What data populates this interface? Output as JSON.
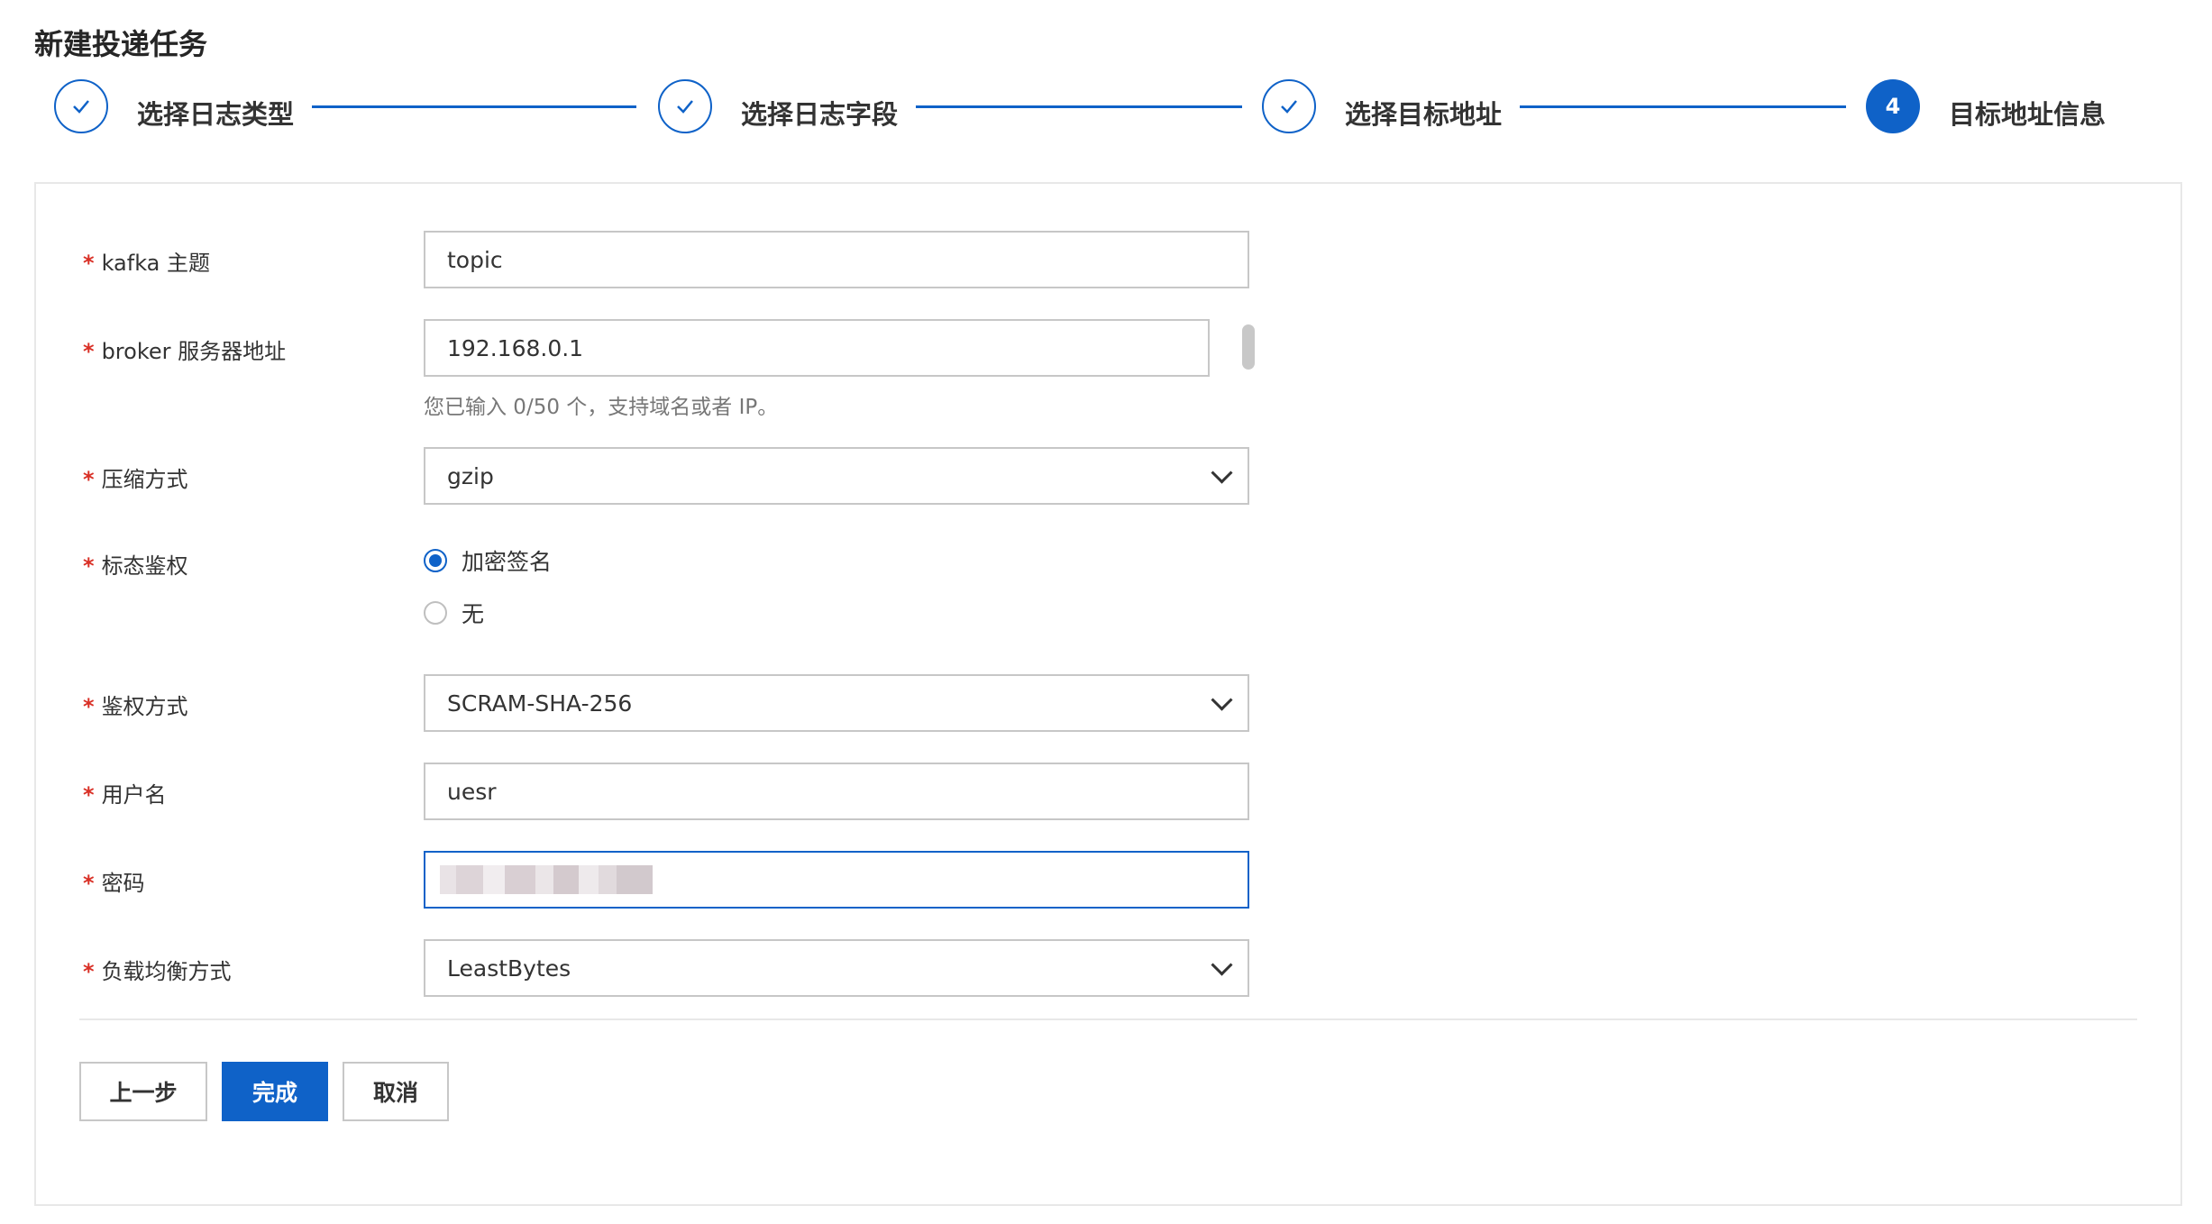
{
  "page": {
    "title": "新建投递任务"
  },
  "steps": [
    {
      "label": "选择日志类型",
      "status": "done"
    },
    {
      "label": "选择日志字段",
      "status": "done"
    },
    {
      "label": "选择目标地址",
      "status": "done"
    },
    {
      "label": "目标地址信息",
      "status": "active",
      "number": "4"
    }
  ],
  "form": {
    "required_mark": "*",
    "kafka_topic": {
      "label": "kafka 主题",
      "value": "topic"
    },
    "broker": {
      "label": "broker 服务器地址",
      "value": "192.168.0.1",
      "help": "您已输入 0/50 个，支持域名或者 IP。"
    },
    "compression": {
      "label": "压缩方式",
      "value": "gzip"
    },
    "auth": {
      "label": "标态鉴权",
      "options": [
        {
          "label": "加密签名",
          "checked": true
        },
        {
          "label": "无",
          "checked": false
        }
      ]
    },
    "auth_method": {
      "label": "鉴权方式",
      "value": "SCRAM-SHA-256"
    },
    "username": {
      "label": "用户名",
      "value": "uesr"
    },
    "password": {
      "label": "密码"
    },
    "load_balance": {
      "label": "负载均衡方式",
      "value": "LeastBytes"
    }
  },
  "buttons": {
    "prev": "上一步",
    "finish": "完成",
    "cancel": "取消"
  },
  "colors": {
    "accent": "#0f62c8",
    "required": "#d93026"
  }
}
